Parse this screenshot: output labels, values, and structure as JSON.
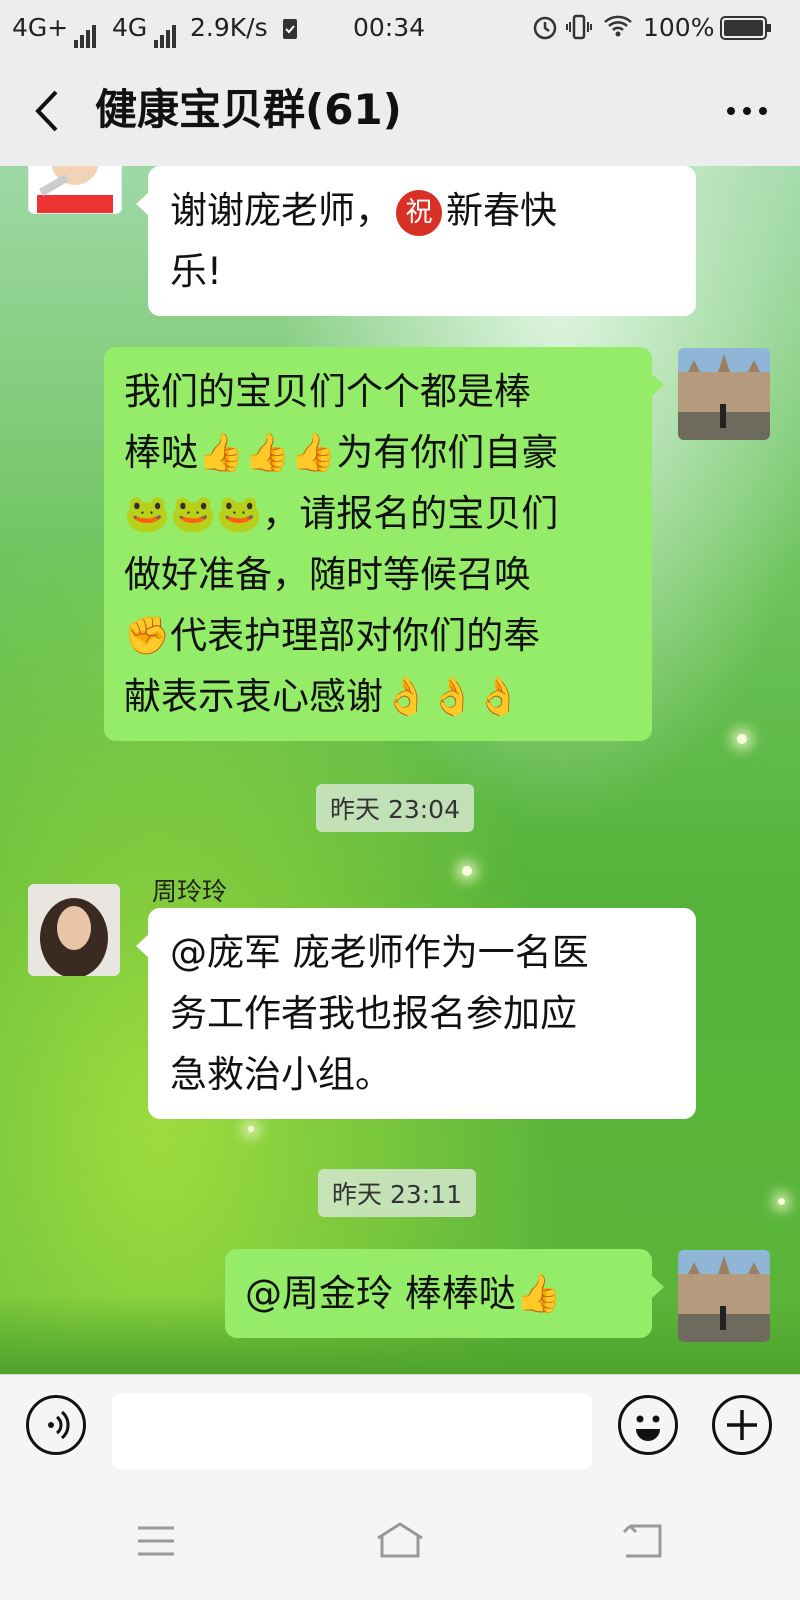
{
  "status_bar": {
    "network1": "4G+",
    "network2": "4G",
    "speed": "2.9K/s",
    "time": "00:34",
    "battery": "100%",
    "icons": [
      "signal-icon",
      "check-icon",
      "alarm-icon",
      "vibrate-icon",
      "wifi-icon",
      "battery-icon"
    ]
  },
  "header": {
    "title": "健康宝贝群(61)",
    "back_icon": "back-icon",
    "more_icon": "more-icon"
  },
  "messages": [
    {
      "direction": "in",
      "text": "谢谢庞老师，🉐新春快乐!",
      "line1": "谢谢庞老师，",
      "badge": "祝",
      "line1b": "新春快",
      "line2": "乐!"
    },
    {
      "direction": "out",
      "lines": [
        "我们的宝贝们个个都是棒",
        "棒哒👍👍👍为有你们自豪",
        "🐸🐸🐸，请报名的宝贝们",
        "做好准备，随时等候召唤",
        "✊代表护理部对你们的奉",
        "献表示衷心感谢👌👌👌"
      ]
    },
    {
      "timestamp": "昨天 23:04"
    },
    {
      "direction": "in",
      "sender": "周玲玲",
      "lines": [
        "@庞军  庞老师作为一名医",
        "务工作者我也报名参加应",
        "急救治小组。"
      ]
    },
    {
      "timestamp": "昨天 23:11"
    },
    {
      "direction": "out",
      "lines": [
        "@周金玲  棒棒哒👍"
      ]
    }
  ],
  "input_bar": {
    "voice_icon": "voice-icon",
    "emoji_icon": "emoji-icon",
    "plus_icon": "plus-icon"
  },
  "navbar": {
    "icons": [
      "menu-icon",
      "home-icon",
      "return-icon"
    ]
  },
  "colors": {
    "out_bubble": "#95ec69",
    "in_bubble": "#ffffff",
    "header_bg": "#ededed"
  }
}
